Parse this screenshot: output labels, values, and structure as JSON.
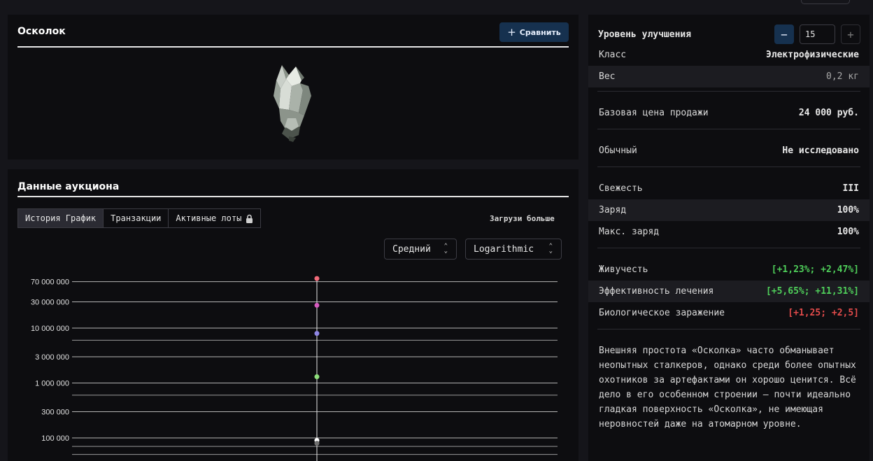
{
  "item": {
    "title": "Осколок",
    "compare_label": "Сравнить",
    "image_icon": "crystal-icon"
  },
  "auction": {
    "title": "Данные аукциона",
    "tabs": [
      "История График",
      "Транзакции",
      "Активные лоты"
    ],
    "active_tab": 0,
    "lock_icon": "lock-icon",
    "load_more": "Загрузи больше",
    "selects": {
      "aggregate": "Средний",
      "scale": "Logarithmic"
    }
  },
  "chart_data": {
    "type": "scatter",
    "y_scale": "log",
    "y_ticks": [
      "70 000 000",
      "30 000 000",
      "10 000 000",
      "3 000 000",
      "1 000 000",
      "300 000",
      "100 000"
    ],
    "grid": true,
    "series": [
      {
        "y": 80000000,
        "color": "#f26b7a"
      },
      {
        "y": 26000000,
        "color": "#d75bbf"
      },
      {
        "y": 8000000,
        "color": "#8f87e6"
      },
      {
        "y": 1300000,
        "color": "#8fe07c"
      },
      {
        "y": 90000,
        "color": "#ffffff"
      },
      {
        "y": 80000,
        "color": "#707070"
      }
    ]
  },
  "stats": {
    "level_label": "Уровень улучшения",
    "level_value": "15",
    "rows": [
      {
        "label": "Класс",
        "value": "Электрофизические"
      },
      {
        "label": "Вес",
        "value": "0,2 кг"
      },
      {
        "label": "Базовая цена продажи",
        "value": "24 000 руб."
      },
      {
        "label": "Обычный",
        "value": "Не исследовано"
      },
      {
        "label": "Свежесть",
        "value": "III"
      },
      {
        "label": "Заряд",
        "value": "100%"
      },
      {
        "label": "Макс. заряд",
        "value": "100%"
      },
      {
        "label": "Живучесть",
        "value": "[+1,23%; +2,47%]"
      },
      {
        "label": "Эффективность лечения",
        "value": "[+5,65%; +11,31%]"
      },
      {
        "label": "Биологическое заражение",
        "value": "[+1,25; +2,5]"
      }
    ],
    "description": "Внешняя простота «Осколка» часто обманывает неопытных сталкеров, однако среди более опытных охотников за артефактами он хорошо ценится. Всё дело в его особенном строении – почти идеально гладкая поверхность «Осколка», не имеющая неровностей даже на атомарном уровне."
  },
  "colors": {
    "accent_button": "#16314f",
    "positive": "#4fcf5a",
    "negative": "#e34b4b"
  }
}
